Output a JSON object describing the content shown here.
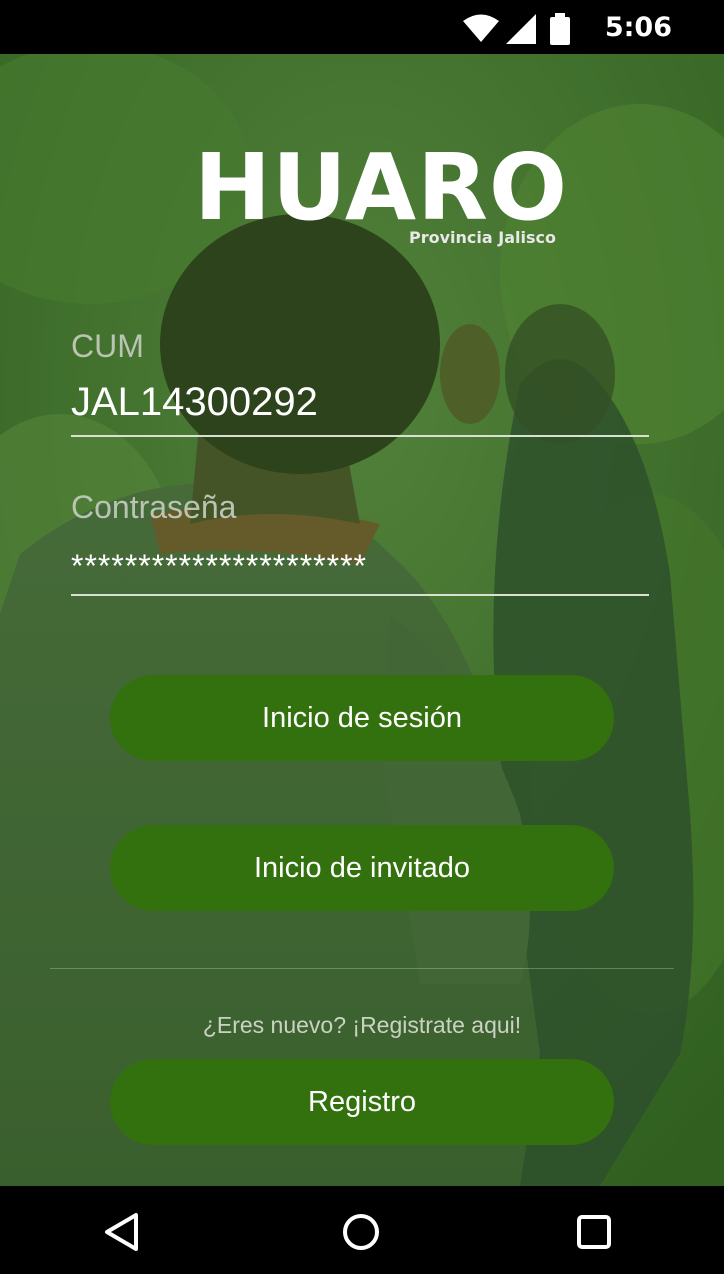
{
  "status_bar": {
    "time": "5:06",
    "icons": [
      "wifi-icon",
      "signal-icon",
      "battery-icon"
    ]
  },
  "logo": {
    "title": "HUARO",
    "subtitle": "Provincia Jalisco"
  },
  "form": {
    "cum_label": "CUM",
    "cum_value": "JAL14300292",
    "password_label": "Contraseña",
    "password_value": "**********************"
  },
  "buttons": {
    "login": "Inicio de sesión",
    "guest": "Inicio de invitado",
    "register": "Registro"
  },
  "register_hint": "¿Eres nuevo? ¡Registrate aqui!",
  "nav_bar": {
    "icons": [
      "back-icon",
      "home-icon",
      "recent-apps-icon"
    ]
  },
  "colors": {
    "button": "#33700e",
    "overlay": "#346e14",
    "text": "#ffffff"
  }
}
